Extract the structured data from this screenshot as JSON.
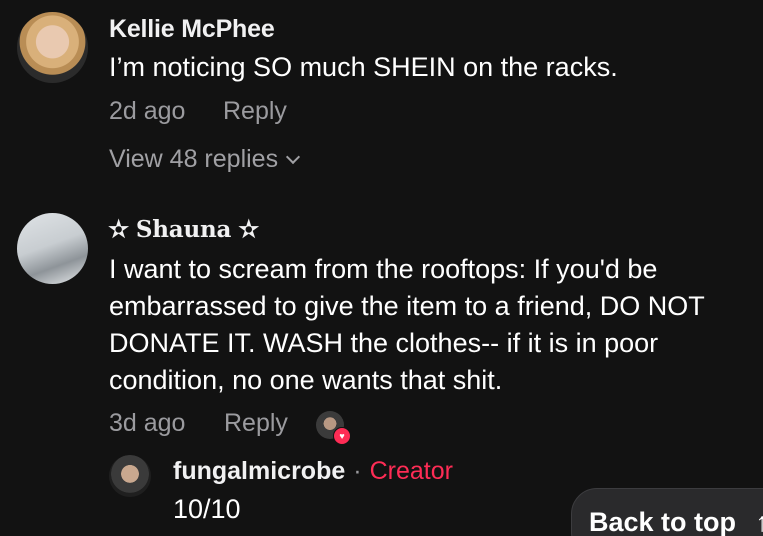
{
  "comments": [
    {
      "username": "Kellie McPhee",
      "text": "I’m noticing SO much SHEIN on the racks.",
      "time": "2d ago",
      "reply_label": "Reply",
      "view_replies": "View 48 replies",
      "avatar_icon": "avatar-photo-blonde-woman"
    },
    {
      "username": "✫ 𝐒𝐡𝐚𝐮𝐧𝐚 ✫",
      "text": "I want to scream from the rooftops: If you'd be embarrassed to give the item to a friend, DO NOT DONATE IT. WASH the clothes-- if it is in poor condition, no one wants that shit.",
      "time": "3d ago",
      "reply_label": "Reply",
      "liked_by_creator_icon": "heart-icon",
      "avatar_icon": "avatar-photo-reclining-person",
      "replies": [
        {
          "username": "fungalmicrobe",
          "separator": "·",
          "tag": "Creator",
          "text": "10/10"
        }
      ]
    }
  ],
  "back_to_top": {
    "label": "Back to top",
    "icon": "↑"
  },
  "colors": {
    "background": "#121212",
    "creator_tag": "#fe2c55",
    "secondary_text": "#9b9b9f"
  }
}
